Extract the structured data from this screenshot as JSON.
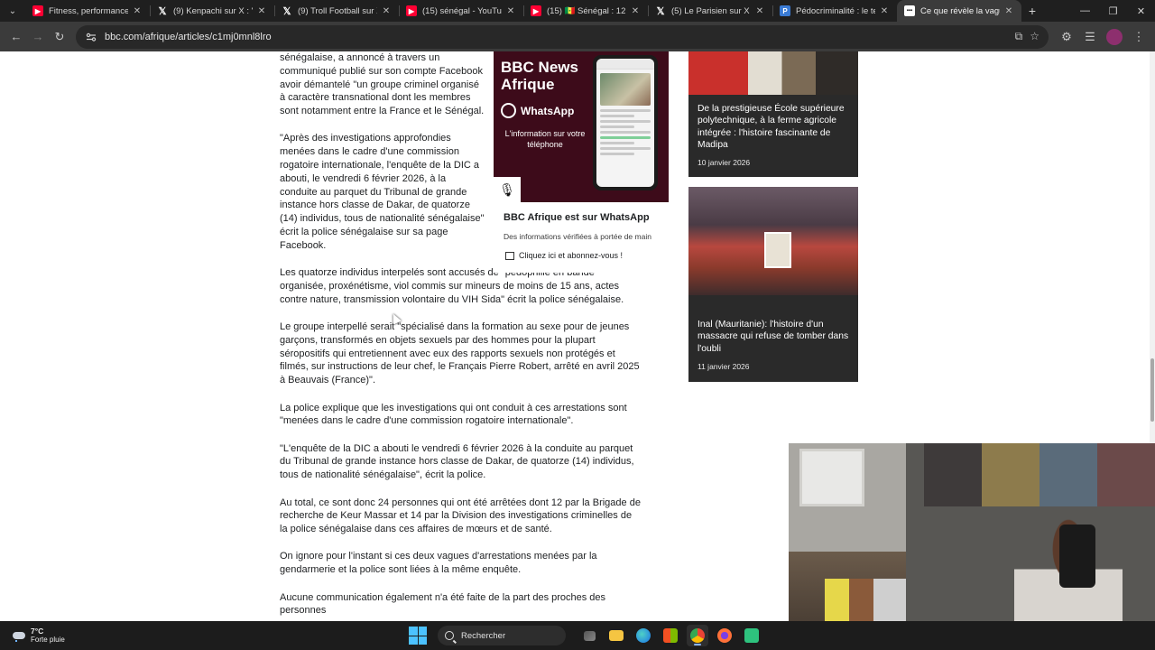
{
  "browser": {
    "tabs": [
      {
        "title": "Fitness, performances : nu",
        "favicon": "youtube-icon"
      },
      {
        "title": "(9) Kenpachi sur X : \"Kylia",
        "favicon": "x-icon"
      },
      {
        "title": "(9) Troll Football sur X : \"A",
        "favicon": "x-icon"
      },
      {
        "title": "(15) sénégal - YouTube",
        "favicon": "youtube-icon"
      },
      {
        "title": "(15) 🇸🇳 Sénégal : 12 perso",
        "favicon": "youtube-icon"
      },
      {
        "title": "(5) Le Parisien sur X : \"Pé",
        "favicon": "x-icon"
      },
      {
        "title": "Pédocriminalité : le terrifi",
        "favicon": "wiki-icon"
      },
      {
        "title": "Ce que révèle la vague d'",
        "favicon": "bbc-icon"
      }
    ],
    "url": "bbc.com/afrique/articles/c1mj0mnl8lro"
  },
  "article": {
    "paragraphs": [
      "sénégalaise, a annoncé à travers un communiqué publié sur son compte Facebook avoir démantelé \"un groupe criminel organisé à caractère transnational dont les membres sont notamment entre la France et le Sénégal.",
      "\"Après des investigations approfondies menées dans le cadre d'une commission rogatoire internationale, l'enquête de la DIC a abouti, le vendredi 6 février 2026, à la conduite au parquet du Tribunal de grande instance hors classe de Dakar, de quatorze (14) individus, tous de nationalité sénégalaise\" écrit la police sénégalaise sur sa page Facebook.",
      "Les quatorze individus interpelés sont accusés de \"pédophilie en bande organisée, proxénétisme, viol commis sur mineurs de moins de 15 ans, actes contre nature, transmission volontaire du VIH Sida\" écrit la police sénégalaise.",
      "Le groupe interpellé serait \"spécialisé dans la formation au sexe pour de jeunes garçons, transformés en objets sexuels par des hommes pour la plupart séropositifs qui entretiennent avec eux des rapports sexuels non protégés et filmés, sur instructions de leur chef, le Français Pierre Robert, arrêté en avril 2025 à Beauvais (France)\".",
      "La police explique que les investigations qui ont conduit à ces arrestations sont \"menées dans le cadre d'une commission rogatoire internationale\".",
      "\"L'enquête de la DIC a abouti le vendredi 6 février 2026 à la conduite au parquet du Tribunal de grande instance hors classe de Dakar, de quatorze (14) individus, tous de nationalité sénégalaise\", écrit la police.",
      "Au total, ce sont donc 24 personnes qui ont été arrêtées dont 12 par la Brigade de recherche de Keur Massar et 14 par la Division des investigations criminelles de la police sénégalaise dans ces affaires de mœurs et de santé.",
      "On ignore pour l'instant si ces deux vagues d'arrestations menées par la gendarmerie et la police sont liées à la même enquête.",
      "Aucune communication également n'a été faite de la part des proches des personnes"
    ]
  },
  "whatsapp_promo": {
    "brand": "BBC News Afrique",
    "wa_label": "WhatsApp",
    "tagline": "L'information sur votre téléphone",
    "title": "BBC Afrique est sur WhatsApp",
    "subtitle": "Des informations vérifiées à portée de main",
    "cta": "Cliquez ici et abonnez-vous !"
  },
  "sidebar": [
    {
      "headline": "De la prestigieuse École supérieure polytechnique, à la ferme agricole intégrée : l'histoire fascinante de Madipa",
      "date": "10 janvier 2026"
    },
    {
      "headline": "Inal (Mauritanie): l'histoire d'un massacre qui refuse de tomber dans l'oubli",
      "date": "11 janvier 2026"
    }
  ],
  "taskbar": {
    "temperature": "7°C",
    "condition": "Forte pluie",
    "search_label": "Rechercher"
  },
  "colors": {
    "promo_bg": "#3d0b1a",
    "sidebar_card_bg": "#2a2a2a",
    "tab_bar": "#1f1f1f",
    "toolbar": "#3b3b3b",
    "taskbar": "#1c1c1c"
  }
}
